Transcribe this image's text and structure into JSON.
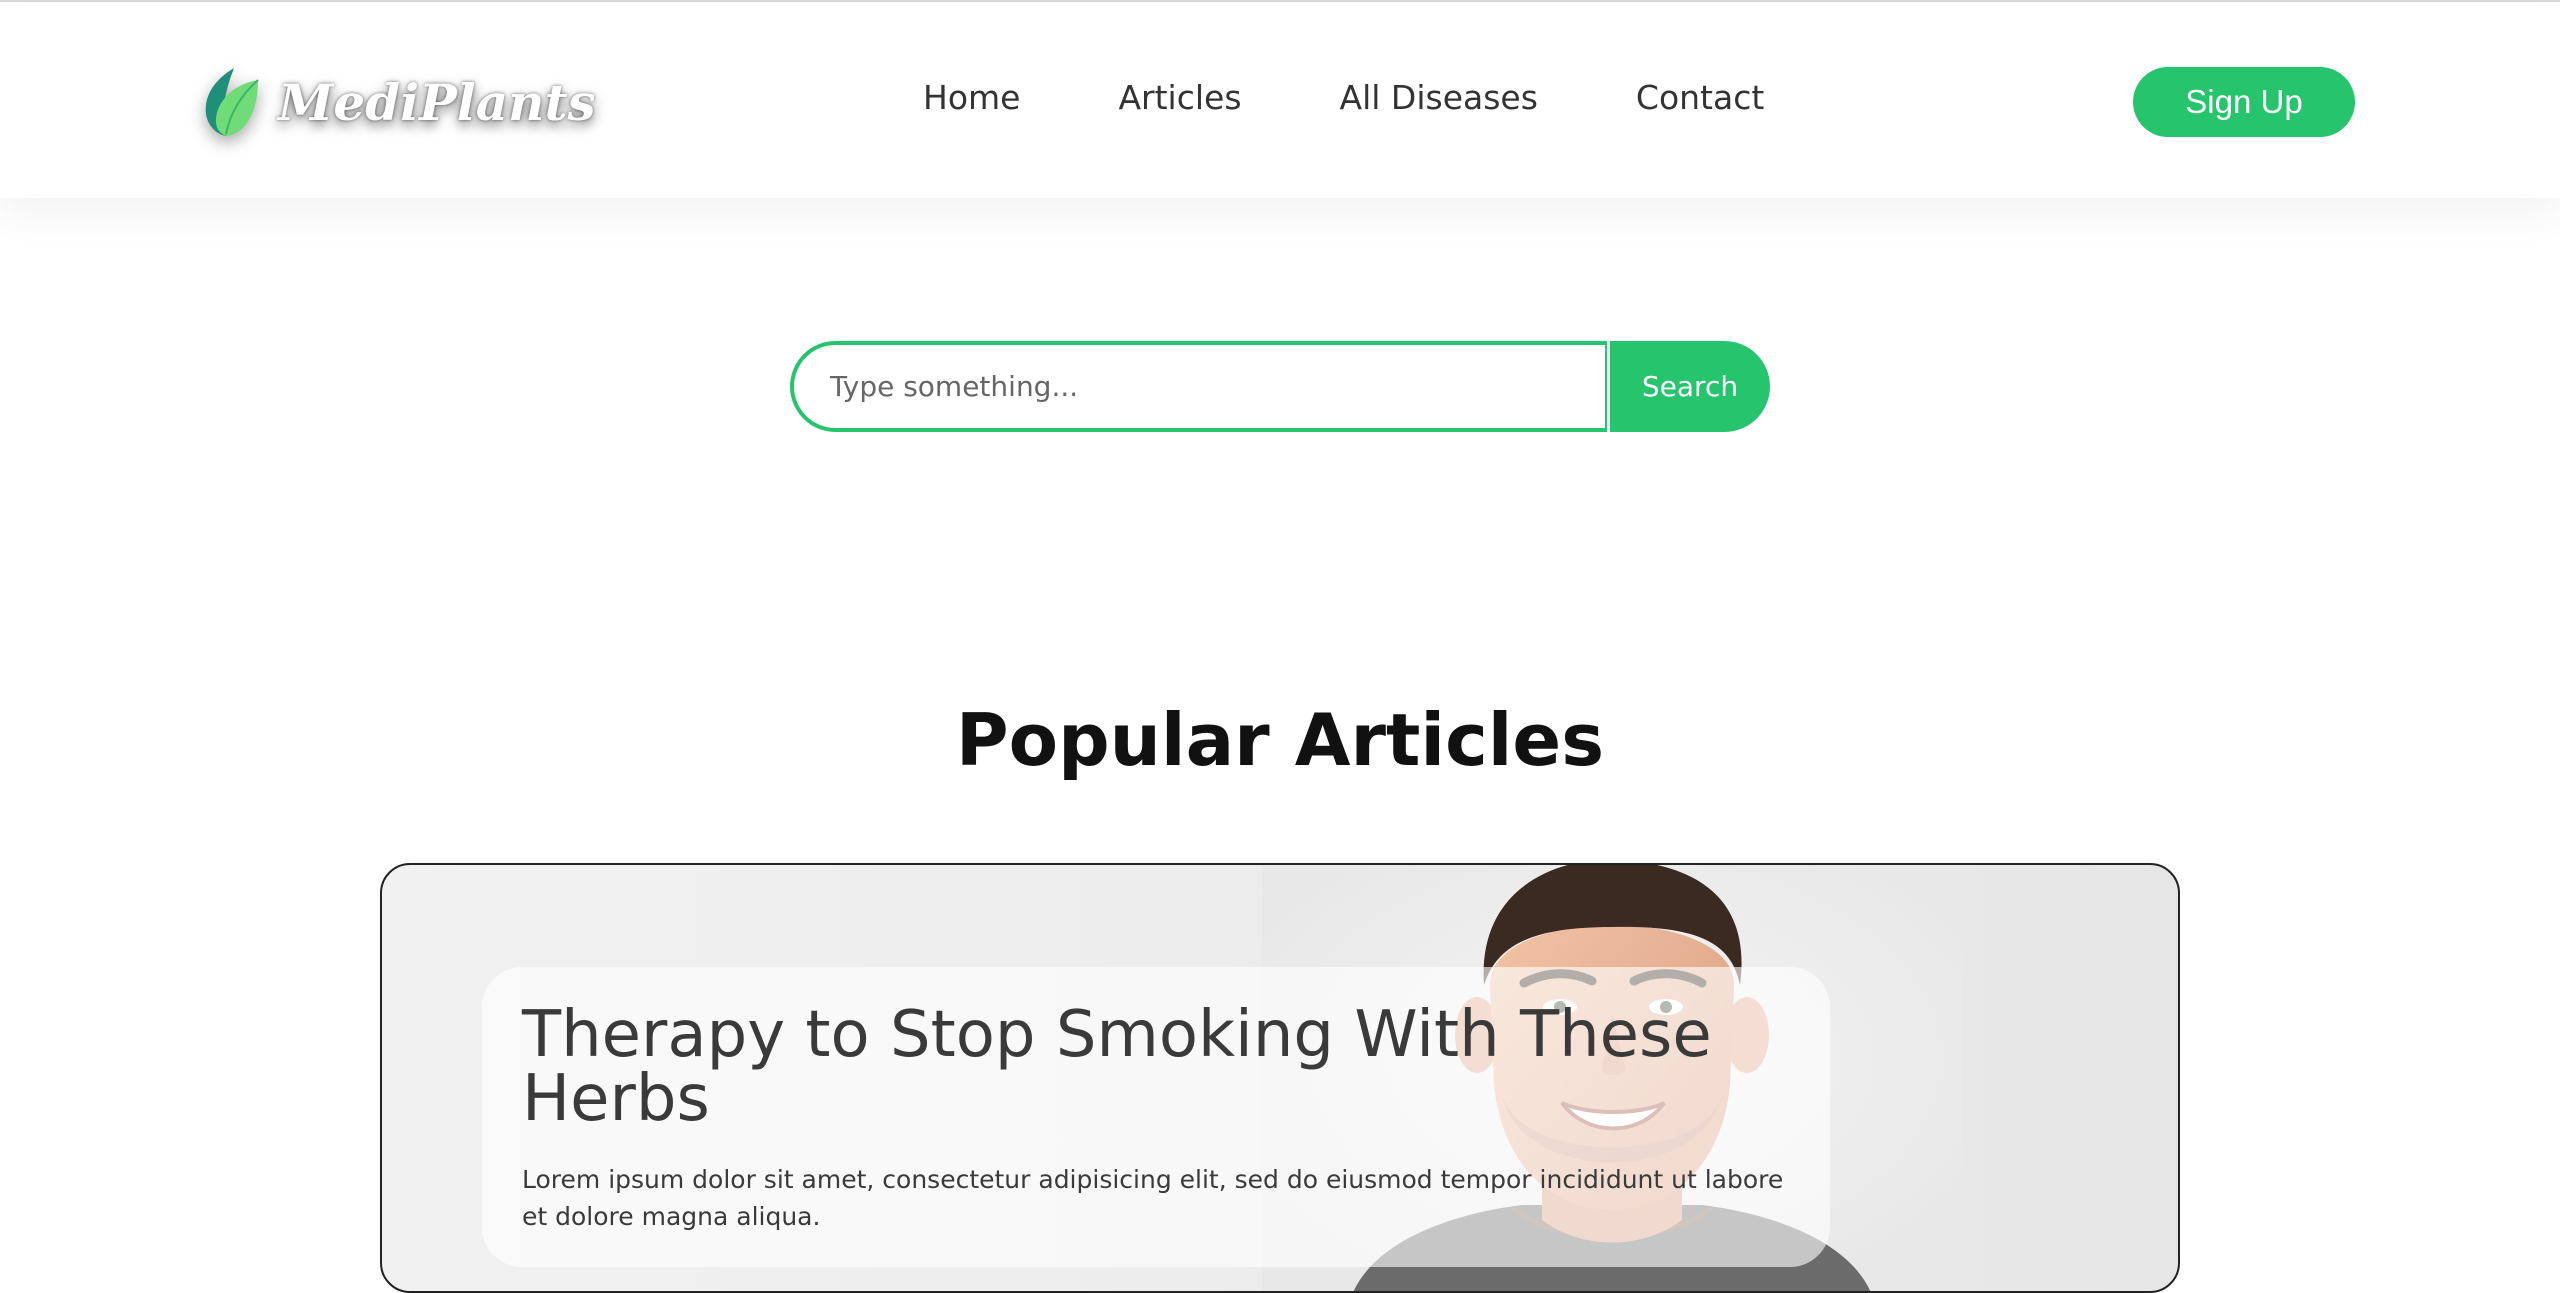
{
  "brand": {
    "name": "MediPlants",
    "accent_color": "#27c46e"
  },
  "nav": {
    "links": [
      {
        "label": "Home"
      },
      {
        "label": "Articles"
      },
      {
        "label": "All Diseases"
      },
      {
        "label": "Contact"
      }
    ],
    "signup_label": "Sign Up"
  },
  "search": {
    "placeholder": "Type something...",
    "value": "",
    "button_label": "Search"
  },
  "popular": {
    "heading": "Popular Articles",
    "articles": [
      {
        "title": "Therapy to Stop Smoking With These Herbs",
        "excerpt": "Lorem ipsum dolor sit amet, consectetur adipisicing elit, sed do eiusmod tempor incididunt ut labore et dolore magna aliqua.",
        "image_icon": "smiling-man-photo"
      }
    ]
  }
}
